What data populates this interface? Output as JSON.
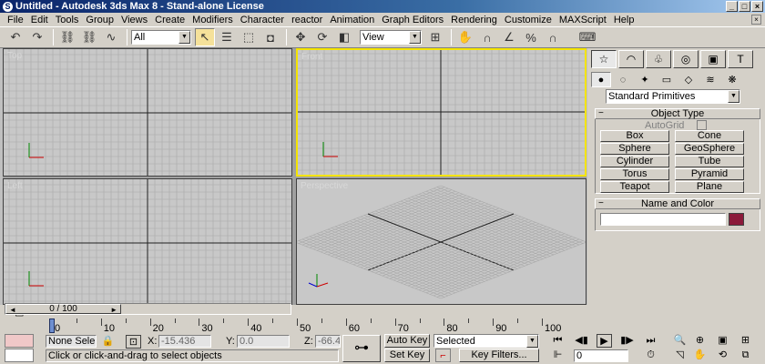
{
  "window": {
    "title": "Untitled - Autodesk 3ds Max 8 - Stand-alone License",
    "app_icon": "S"
  },
  "menu": [
    "File",
    "Edit",
    "Tools",
    "Group",
    "Views",
    "Create",
    "Modifiers",
    "Character",
    "reactor",
    "Animation",
    "Graph Editors",
    "Rendering",
    "Customize",
    "MAXScript",
    "Help"
  ],
  "toolbar": {
    "selection_filter": "All",
    "coord_system": "View"
  },
  "viewports": {
    "top": "Top",
    "front": "Front",
    "left": "Left",
    "perspective": "Perspective"
  },
  "command_panel": {
    "category_dropdown": "Standard Primitives",
    "object_type_header": "Object Type",
    "autogrid_label": "AutoGrid",
    "object_buttons": [
      "Box",
      "Cone",
      "Sphere",
      "GeoSphere",
      "Cylinder",
      "Tube",
      "Torus",
      "Pyramid",
      "Teapot",
      "Plane"
    ],
    "name_color_header": "Name and Color",
    "object_name": "",
    "object_color": "#8b1a3a"
  },
  "timeline": {
    "frame_counter": "0 / 100",
    "ticks": [
      0,
      10,
      20,
      30,
      40,
      50,
      60,
      70,
      80,
      90,
      100
    ],
    "progress": 0
  },
  "status": {
    "selection_status": "None Sele",
    "x_value": "-15.436",
    "y_value": "0.0",
    "z_value": "-66.4",
    "x_label": "X:",
    "y_label": "Y:",
    "z_label": "Z:",
    "prompt": "Click or click-and-drag to select objects",
    "auto_key": "Auto Key",
    "set_key": "Set Key",
    "key_mode": "Selected",
    "key_filters": "Key Filters...",
    "current_frame": "0"
  },
  "colors": {
    "active_viewport": "#f4e400",
    "titlebar": "#0a246a"
  }
}
